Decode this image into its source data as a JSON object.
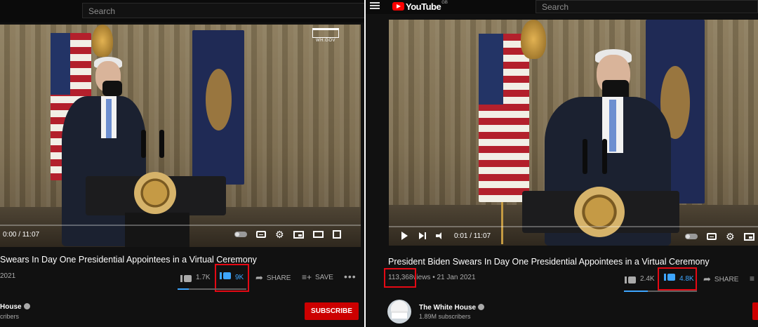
{
  "left": {
    "search": {
      "placeholder": "Search"
    },
    "video": {
      "watermark": "WH.GOV"
    },
    "player": {
      "time": "0:00 / 11:07"
    },
    "title": "Swears In Day One Presidential Appointees in a Virtual Ceremony",
    "meta": {
      "date": "2021"
    },
    "actions": {
      "like_count": "1.7K",
      "dislike_count": "9K",
      "share_label": "SHARE",
      "save_label": "SAVE",
      "more_label": "•••"
    },
    "channel": {
      "name": "House",
      "subscribers": "cribers"
    },
    "subscribe_label": "SUBSCRIBE"
  },
  "right": {
    "search": {
      "placeholder": "Search"
    },
    "brand": {
      "name": "YouTube",
      "region": "GB"
    },
    "player": {
      "time": "0:01 / 11:07"
    },
    "title": "President Biden Swears In Day One Presidential Appointees in a Virtual Ceremony",
    "meta": {
      "views": "113,368",
      "views_suffix": "views • 21 Jan 2021"
    },
    "actions": {
      "like_count": "2.4K",
      "dislike_count": "4.8K",
      "share_label": "SHARE"
    },
    "channel": {
      "name": "The White House",
      "subscribers": "1.89M subscribers"
    }
  },
  "colors": {
    "highlight_box": "#e50914",
    "dislike_active": "#3ea6ff",
    "subscribe_button": "#cc0000",
    "brand_red": "#ff0000"
  },
  "icons": {
    "like": "thumbs-up-icon",
    "dislike": "thumbs-down-icon",
    "share": "share-arrow-icon",
    "save": "playlist-add-icon",
    "settings": "gear-icon",
    "captions": "captions-icon",
    "miniplayer": "miniplayer-icon",
    "theater": "theater-mode-icon",
    "fullscreen": "fullscreen-icon",
    "menu": "hamburger-menu-icon",
    "verified": "verified-badge-icon"
  },
  "like_ratio": {
    "left": 0.16,
    "right": 0.33
  }
}
